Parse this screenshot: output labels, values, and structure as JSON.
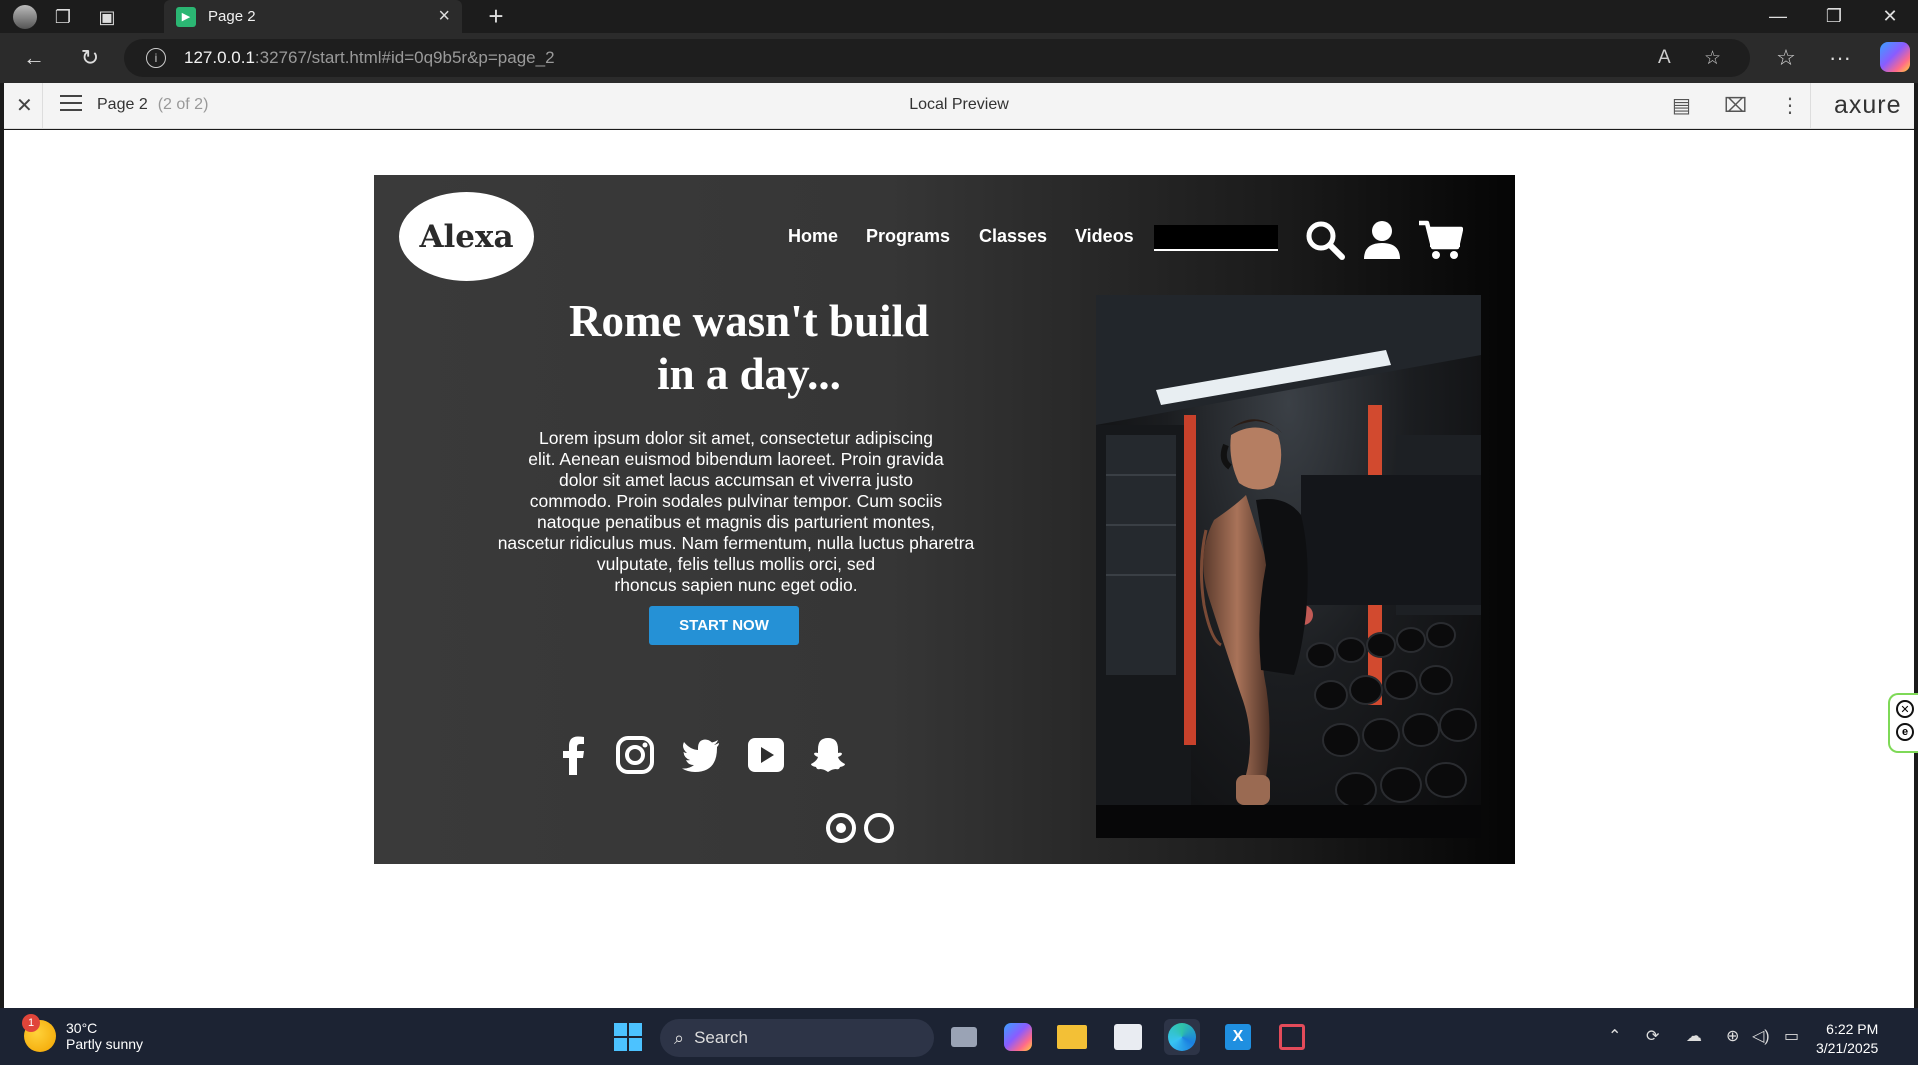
{
  "browser": {
    "tab_title": "Page 2",
    "url_host": "127.0.0.1",
    "url_rest": ":32767/start.html#id=0q9b5r&p=page_2"
  },
  "axure": {
    "page_name": "Page 2",
    "page_count": "(2 of 2)",
    "title": "Local Preview",
    "logo": "axure"
  },
  "site": {
    "logo": "Alexa",
    "nav": [
      "Home",
      "Programs",
      "Classes",
      "Videos"
    ],
    "headline_line1": "Rome wasn't build",
    "headline_line2": "in a day...",
    "paragraph_lines": [
      "Lorem ipsum dolor sit amet, consectetur adipiscing",
      "elit. Aenean euismod bibendum laoreet. Proin gravida",
      "dolor sit amet lacus accumsan et viverra justo",
      "commodo. Proin sodales pulvinar tempor. Cum sociis",
      "natoque penatibus et magnis dis parturient montes,",
      "nascetur ridiculus mus. Nam fermentum, nulla luctus pharetra",
      "vulputate, felis tellus mollis orci, sed",
      "rhoncus sapien nunc eget odio."
    ],
    "cta": "START NOW",
    "social_icons": [
      "facebook-icon",
      "instagram-icon",
      "twitter-icon",
      "youtube-icon",
      "snapchat-icon"
    ],
    "carousel": {
      "total": 2,
      "active": 1
    },
    "accent_color": "#2591d6"
  },
  "taskbar": {
    "temp": "30°C",
    "condition": "Partly sunny",
    "weather_badge": "1",
    "search_placeholder": "Search",
    "time": "6:22 PM",
    "date": "3/21/2025"
  }
}
